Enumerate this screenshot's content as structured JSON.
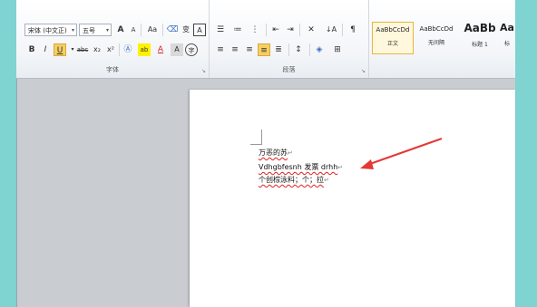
{
  "ribbon": {
    "font_group": {
      "label": "字体",
      "font_name": "宋体 (中文正)",
      "font_size": "五号",
      "grow": "A",
      "shrink": "A",
      "case": "Aa",
      "phonetic": "变",
      "border": "A",
      "bold": "B",
      "italic": "I",
      "underline": "U",
      "strike": "abc",
      "subscript": "x₂",
      "superscript": "x²",
      "highlight": "ab",
      "font_color": "A",
      "char_shade": "A",
      "enclose": "字"
    },
    "paragraph_group": {
      "label": "段落",
      "sort": "↓A"
    },
    "styles": [
      {
        "sample": "AaBbCcDd",
        "name": "正文"
      },
      {
        "sample": "AaBbCcDd",
        "name": "无间隔"
      },
      {
        "sample": "AaBb",
        "name": "标题 1"
      },
      {
        "sample": "Aa",
        "name": "标"
      }
    ]
  },
  "document": {
    "lines": [
      "万恶的苏",
      "Vdhgbfesnh 发票 drhh",
      "个创棕泳料；个；拉"
    ],
    "para_mark": "↵"
  },
  "colors": {
    "background": "#7fd3d0",
    "arrow": "#e53935",
    "highlight_button": "#f5cf62"
  }
}
